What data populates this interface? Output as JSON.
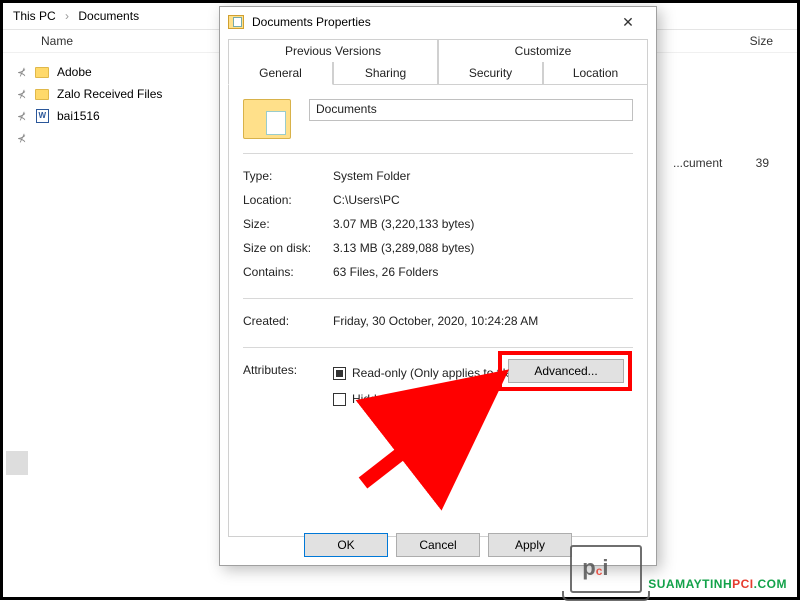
{
  "breadcrumb": {
    "root": "This PC",
    "current": "Documents"
  },
  "columns": {
    "name": "Name",
    "size": "Size"
  },
  "files": [
    {
      "name": "Adobe",
      "type": "folder"
    },
    {
      "name": "Zalo Received Files",
      "type": "folder"
    },
    {
      "name": "bai1516",
      "type": "word"
    }
  ],
  "bg_row": {
    "type_suffix": "...cument",
    "size": "39"
  },
  "dialog": {
    "title": "Documents Properties",
    "tabs_top": [
      "Previous Versions",
      "Customize"
    ],
    "tabs_bottom": [
      "General",
      "Sharing",
      "Security",
      "Location"
    ],
    "active_tab": "General",
    "name_value": "Documents",
    "props": {
      "type_label": "Type:",
      "type": "System Folder",
      "location_label": "Location:",
      "location": "C:\\Users\\PC",
      "size_label": "Size:",
      "size": "3.07 MB (3,220,133 bytes)",
      "disk_label": "Size on disk:",
      "disk": "3.13 MB (3,289,088 bytes)",
      "contains_label": "Contains:",
      "contains": "63 Files, 26 Folders",
      "created_label": "Created:",
      "created": "Friday, 30 October, 2020, 10:24:28 AM",
      "attr_label": "Attributes:",
      "readonly": "Read-only (Only applies to files in folder)",
      "hidden": "Hidden",
      "advanced": "Advanced..."
    },
    "buttons": {
      "ok": "OK",
      "cancel": "Cancel",
      "apply": "Apply"
    }
  },
  "watermark": {
    "logo": "pci",
    "text1": "SUAMAYTINH",
    "text2": "PCI",
    "text3": ".COM"
  }
}
